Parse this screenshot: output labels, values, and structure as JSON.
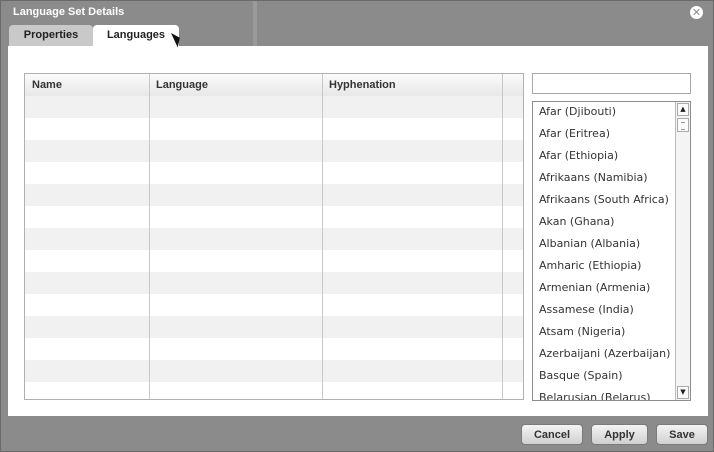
{
  "dialog": {
    "title": "Language Set Details",
    "close_icon": "close-icon"
  },
  "tabs": [
    {
      "label": "Properties",
      "active": false
    },
    {
      "label": "Languages",
      "active": true
    }
  ],
  "table": {
    "columns": [
      "Name",
      "Language",
      "Hyphenation",
      ""
    ],
    "rows": []
  },
  "search": {
    "value": "",
    "placeholder": ""
  },
  "languages": [
    "Afar (Djibouti)",
    "Afar (Eritrea)",
    "Afar (Ethiopia)",
    "Afrikaans (Namibia)",
    "Afrikaans (South Africa)",
    "Akan (Ghana)",
    "Albanian (Albania)",
    "Amharic (Ethiopia)",
    "Armenian (Armenia)",
    "Assamese (India)",
    "Atsam (Nigeria)",
    "Azerbaijani (Azerbaijan)",
    "Basque (Spain)",
    "Belarusian (Belarus)"
  ],
  "buttons": {
    "cancel": "Cancel",
    "apply": "Apply",
    "save": "Save"
  },
  "colors": {
    "dialog_bg": "#8b8b8b",
    "panel_bg": "#ffffff",
    "row_alt": "#f1f1f1"
  }
}
